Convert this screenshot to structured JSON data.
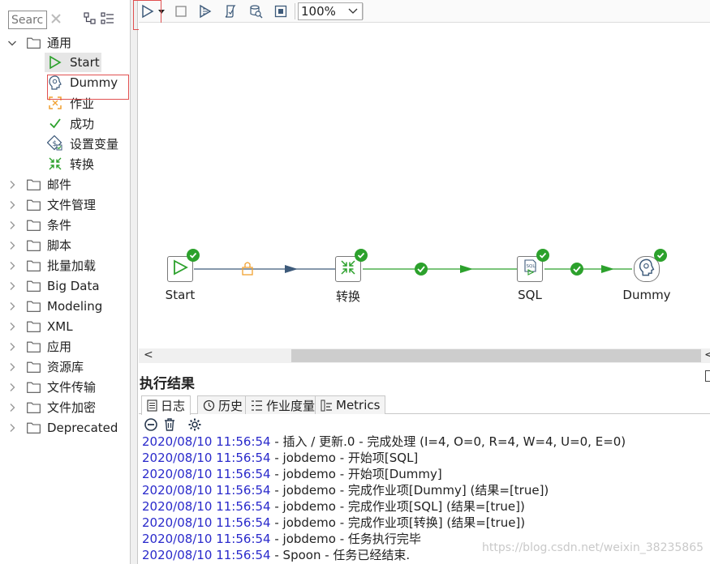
{
  "search": {
    "placeholder": "Search"
  },
  "tree": {
    "expanded_folder": "通用",
    "general_items": [
      {
        "label": "Start",
        "icon": "start-icon"
      },
      {
        "label": "Dummy",
        "icon": "dummy-icon"
      },
      {
        "label": "作业",
        "icon": "job-icon"
      },
      {
        "label": "成功",
        "icon": "success-icon"
      },
      {
        "label": "设置变量",
        "icon": "set-variables-icon"
      },
      {
        "label": "转换",
        "icon": "transformation-icon"
      }
    ],
    "folders": [
      "邮件",
      "文件管理",
      "条件",
      "脚本",
      "批量加载",
      "Big Data",
      "Modeling",
      "XML",
      "应用",
      "资源库",
      "文件传输",
      "文件加密",
      "Deprecated"
    ]
  },
  "toolbar": {
    "zoom": "100%"
  },
  "canvas": {
    "nodes": [
      {
        "label": "Start"
      },
      {
        "label": "转换"
      },
      {
        "label": "SQL"
      },
      {
        "label": "Dummy"
      }
    ]
  },
  "results": {
    "title": "执行结果",
    "tabs": [
      "日志",
      "历史",
      "作业度量",
      "Metrics"
    ],
    "log": [
      {
        "ts": "2020/08/10 11:56:54",
        "msg": " - 插入 / 更新.0 - 完成处理 (I=4, O=0, R=4, W=4, U=0, E=0)"
      },
      {
        "ts": "2020/08/10 11:56:54",
        "msg": " - jobdemo - 开始项[SQL]"
      },
      {
        "ts": "2020/08/10 11:56:54",
        "msg": " - jobdemo - 开始项[Dummy]"
      },
      {
        "ts": "2020/08/10 11:56:54",
        "msg": " - jobdemo - 完成作业项[Dummy] (结果=[true])"
      },
      {
        "ts": "2020/08/10 11:56:54",
        "msg": " - jobdemo - 完成作业项[SQL] (结果=[true])"
      },
      {
        "ts": "2020/08/10 11:56:54",
        "msg": " - jobdemo - 完成作业项[转换] (结果=[true])"
      },
      {
        "ts": "2020/08/10 11:56:54",
        "msg": " - jobdemo - 任务执行完毕"
      },
      {
        "ts": "2020/08/10 11:56:54",
        "msg": " - Spoon - 任务已经结束."
      }
    ]
  },
  "watermark": "https://blog.csdn.net/weixin_38235865",
  "colors": {
    "success": "#2ca12c",
    "hop": "#3a3a3a",
    "timestamp": "#2a2acb",
    "highlight": "#e05050"
  }
}
